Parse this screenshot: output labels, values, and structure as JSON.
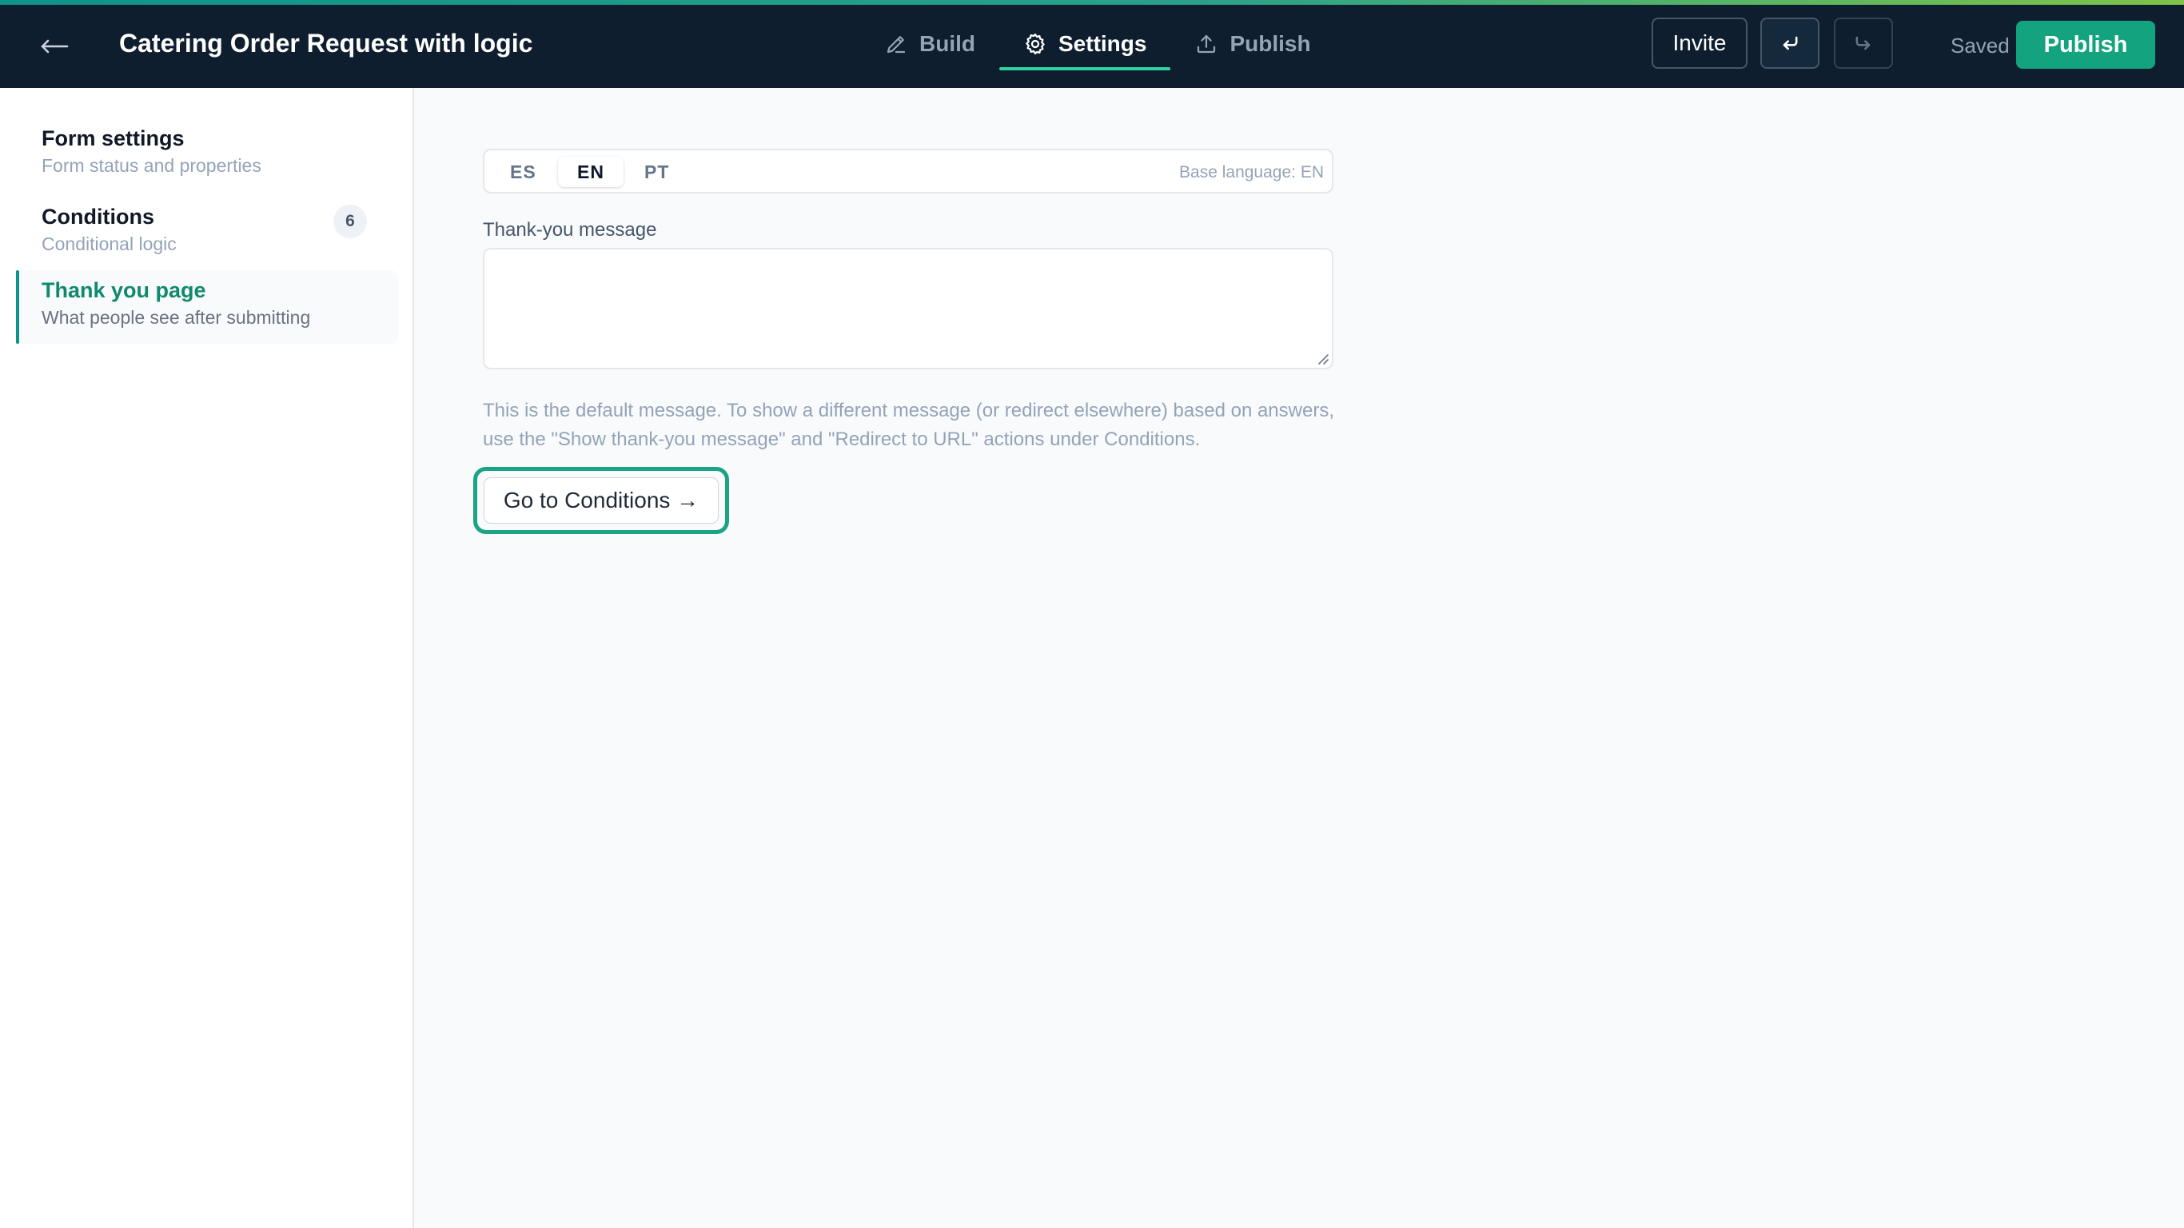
{
  "header": {
    "back_icon": "arrow-left-icon",
    "form_title": "Catering Order Request with logic",
    "tabs": [
      {
        "label": "Build",
        "icon": "pencil-icon",
        "active": false
      },
      {
        "label": "Settings",
        "icon": "gear-icon",
        "active": true
      },
      {
        "label": "Publish",
        "icon": "upload-icon",
        "active": false
      }
    ],
    "invite_label": "Invite",
    "undo_icon": "undo-icon",
    "redo_icon": "redo-icon",
    "saved_status": "Saved",
    "publish_label": "Publish",
    "accent_colors": [
      "#0d9488",
      "#7fc447"
    ]
  },
  "sidebar": {
    "items": [
      {
        "title": "Form settings",
        "subtitle": "Form status and properties"
      },
      {
        "title": "Conditions",
        "subtitle": "Conditional logic",
        "badge": "6"
      },
      {
        "title": "Thank you page",
        "subtitle": "What people see after submitting",
        "active": true
      }
    ]
  },
  "main": {
    "languages": [
      {
        "code": "ES",
        "active": false
      },
      {
        "code": "EN",
        "active": true
      },
      {
        "code": "PT",
        "active": false
      }
    ],
    "base_language": "Base language: EN",
    "message_label": "Thank-you message",
    "message_value": "",
    "help_text": "This is the default message. To show a different message (or redirect elsewhere) based on answers, use the \"Show thank-you message\" and \"Redirect to URL\" actions under Conditions.",
    "goto_conditions_label": "Go to Conditions →"
  },
  "colors": {
    "topbar_bg": "#0f1e2e",
    "brand_green": "#14a37f",
    "active_text": "#0f8a6e",
    "page_bg": "#f8fafc"
  }
}
